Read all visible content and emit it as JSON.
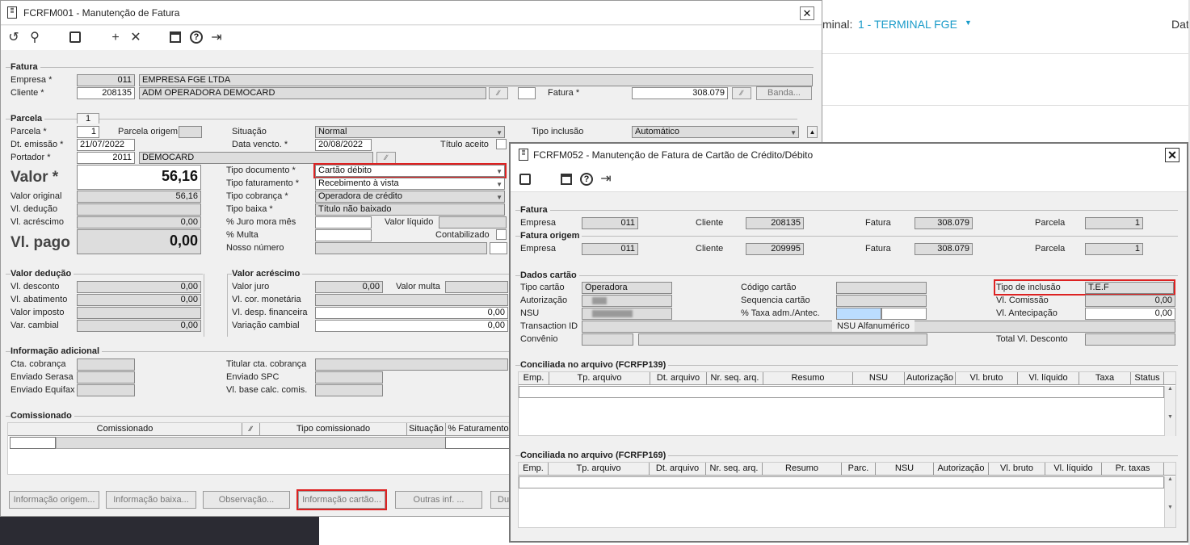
{
  "bg": {
    "terminal_label": "minal:",
    "terminal_value": "1 - TERMINAL FGE",
    "right_text": "Dat"
  },
  "w1": {
    "title": "FCRFM001 - Manutenção de Fatura",
    "fatura": {
      "section": "Fatura",
      "empresa_lbl": "Empresa *",
      "empresa": "011",
      "empresa_nome": "EMPRESA FGE LTDA",
      "cliente_lbl": "Cliente *",
      "cliente": "208135",
      "cliente_nome": "ADM   OPERADORA DEMOCARD",
      "fatura_lbl": "Fatura *",
      "fatura": "308.079",
      "banda_btn": "Banda..."
    },
    "parcela": {
      "section": "Parcela",
      "tab": "1",
      "parcela_lbl": "Parcela *",
      "parcela": "1",
      "parcela_origem_lbl": "Parcela origem",
      "situacao_lbl": "Situação",
      "situacao": "Normal",
      "tipo_inclusao_lbl": "Tipo inclusão",
      "tipo_inclusao": "Automático",
      "dt_emissao_lbl": "Dt. emissão *",
      "dt_emissao": "21/07/2022",
      "data_vencto_lbl": "Data vencto. *",
      "data_vencto": "20/08/2022",
      "titulo_aceito_lbl": "Título aceito",
      "portador_lbl": "Portador *",
      "portador": "2011",
      "portador_nome": "DEMOCARD",
      "valor_lbl": "Valor *",
      "valor": "56,16",
      "tipo_documento_lbl": "Tipo documento *",
      "tipo_documento": "Cartão débito",
      "tipo_faturamento_lbl": "Tipo faturamento *",
      "tipo_faturamento": "Recebimento à vista",
      "valor_original_lbl": "Valor original",
      "valor_original": "56,16",
      "tipo_cobranca_lbl": "Tipo cobrança *",
      "tipo_cobranca": "Operadora de crédito",
      "vl_deducao_lbl": "Vl. dedução",
      "tipo_baixa_lbl": "Tipo baixa *",
      "tipo_baixa": "Título não baixado",
      "vl_acrescimo_lbl": "Vl. acréscimo",
      "vl_acrescimo": "0,00",
      "juro_mora_lbl": "% Juro mora mês",
      "valor_liquido_lbl": "Valor líquido",
      "multa_lbl": "% Multa",
      "contabilizado_lbl": "Contabilizado",
      "vl_pago_lbl": "Vl. pago",
      "vl_pago": "0,00",
      "nosso_numero_lbl": "Nosso número"
    },
    "deducao": {
      "section": "Valor dedução",
      "desconto_lbl": "Vl. desconto",
      "desconto": "0,00",
      "abatimento_lbl": "Vl. abatimento",
      "abatimento": "0,00",
      "imposto_lbl": "Valor imposto",
      "cambial_lbl": "Var. cambial",
      "cambial": "0,00"
    },
    "acrescimo": {
      "section": "Valor acréscimo",
      "juro_lbl": "Valor juro",
      "juro": "0,00",
      "multa_lbl": "Valor multa",
      "cor_lbl": "Vl. cor. monetária",
      "desp_lbl": "Vl. desp. financeira",
      "desp": "0,00",
      "var_lbl": "Variação cambial",
      "var": "0,00"
    },
    "adicional": {
      "section": "Informação adicional",
      "cta_lbl": "Cta. cobrança",
      "serasa_lbl": "Enviado Serasa",
      "equifax_lbl": "Enviado Equifax",
      "titular_lbl": "Titular cta. cobrança",
      "spc_lbl": "Enviado SPC",
      "base_lbl": "Vl. base calc. comis."
    },
    "comissionado": {
      "section": "Comissionado",
      "cols": [
        "Comissionado",
        "Tipo comissionado",
        "Situação",
        "% Faturamento"
      ]
    },
    "buttons": [
      "Informação origem...",
      "Informação baixa...",
      "Observação...",
      "Informação cartão...",
      "Outras inf. ...",
      "Du"
    ]
  },
  "w2": {
    "title": "FCRFM052 - Manutenção de Fatura de Cartão de Crédito/Débito",
    "fatura": {
      "section": "Fatura",
      "empresa_lbl": "Empresa",
      "empresa": "011",
      "cliente_lbl": "Cliente",
      "cliente": "208135",
      "fatura_lbl": "Fatura",
      "fatura": "308.079",
      "parcela_lbl": "Parcela",
      "parcela": "1"
    },
    "origem": {
      "section": "Fatura origem",
      "empresa_lbl": "Empresa",
      "empresa": "011",
      "cliente_lbl": "Cliente",
      "cliente": "209995",
      "fatura_lbl": "Fatura",
      "fatura": "308.079",
      "parcela_lbl": "Parcela",
      "parcela": "1"
    },
    "cartao": {
      "section": "Dados cartão",
      "tipo_lbl": "Tipo cartão",
      "tipo": "Operadora",
      "autorizacao_lbl": "Autorização",
      "nsu_lbl": "NSU",
      "transaction_lbl": "Transaction ID",
      "convenio_lbl": "Convênio",
      "codigo_lbl": "Código cartão",
      "sequencia_lbl": "Sequencia cartão",
      "taxa_lbl": "% Taxa adm./Antec.",
      "nsu_alfa": "NSU Alfanumérico",
      "tipo_inclusao_lbl": "Tipo de inclusão",
      "tipo_inclusao": "T.E.F",
      "comissao_lbl": "Vl. Comissão",
      "comissao": "0,00",
      "antecipacao_lbl": "Vl. Antecipação",
      "antecipacao": "0,00",
      "total_desc_lbl": "Total Vl. Desconto"
    },
    "grid1": {
      "section": "Conciliada no arquivo (FCRFP139)",
      "cols": [
        "Emp.",
        "Tp. arquivo",
        "Dt. arquivo",
        "Nr. seq. arq.",
        "Resumo",
        "NSU",
        "Autorização",
        "Vl. bruto",
        "Vl. líquido",
        "Taxa",
        "Status"
      ]
    },
    "grid2": {
      "section": "Conciliada no arquivo (FCRFP169)",
      "cols": [
        "Emp.",
        "Tp. arquivo",
        "Dt. arquivo",
        "Nr. seq. arq.",
        "Resumo",
        "Parc.",
        "NSU",
        "Autorização",
        "Vl. bruto",
        "Vl. líquido",
        "Pr. taxas"
      ]
    }
  }
}
